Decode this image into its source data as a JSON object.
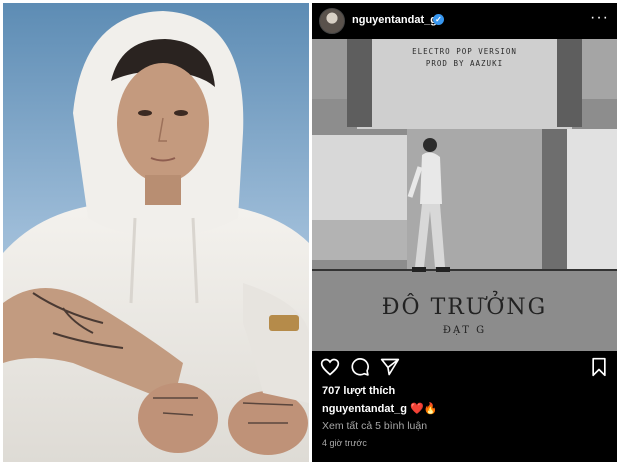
{
  "post": {
    "username": "nguyentandat_g",
    "verified_badge": "✓",
    "more_icon": "···",
    "poster": {
      "line1": "ELECTRO POP VERSION",
      "line2": "PROD BY AAZUKI",
      "title": "ĐÔ TRƯỞNG",
      "artist": "ĐẠT G"
    },
    "likes": "707 lượt thích",
    "caption": {
      "user": "nguyentandat_g",
      "emoji": "❤️🔥"
    },
    "view_comments": "Xem tất cả 5 bình luận",
    "timestamp": "4 giờ trước",
    "colors": {
      "panel_bg": "#000000",
      "verified": "#3897f0",
      "muted_text": "#a8a8a8"
    },
    "icons": [
      "heart-icon",
      "comment-icon",
      "share-icon",
      "bookmark-icon"
    ]
  }
}
